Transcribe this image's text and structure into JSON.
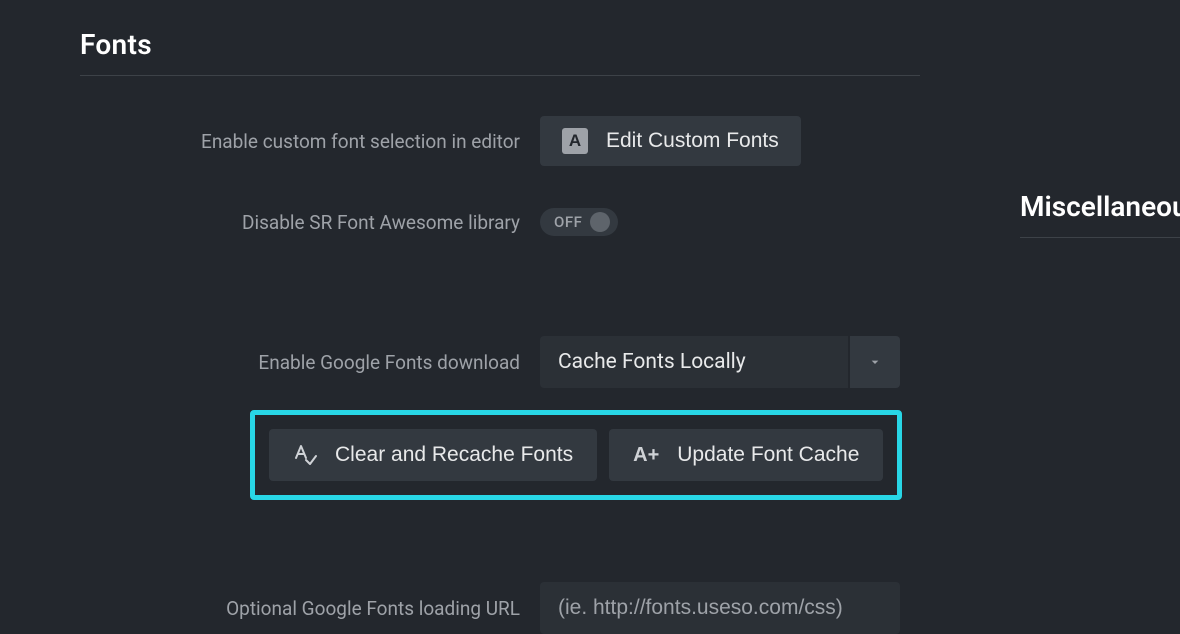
{
  "section": {
    "title": "Fonts"
  },
  "rows": {
    "custom_font_label": "Enable custom font selection in editor",
    "edit_custom_fonts_btn": "Edit Custom Fonts",
    "disable_sr_fa_label": "Disable SR Font Awesome library",
    "toggle_off_text": "OFF",
    "google_fonts_download_label": "Enable Google Fonts download",
    "cache_locally_selected": "Cache Fonts Locally",
    "clear_recache_btn": "Clear and Recache Fonts",
    "update_cache_btn": "Update Font Cache",
    "loading_url_label": "Optional Google Fonts loading URL",
    "loading_url_placeholder": "(ie. http://fonts.useso.com/css)"
  },
  "side": {
    "title": "Miscellaneous"
  }
}
